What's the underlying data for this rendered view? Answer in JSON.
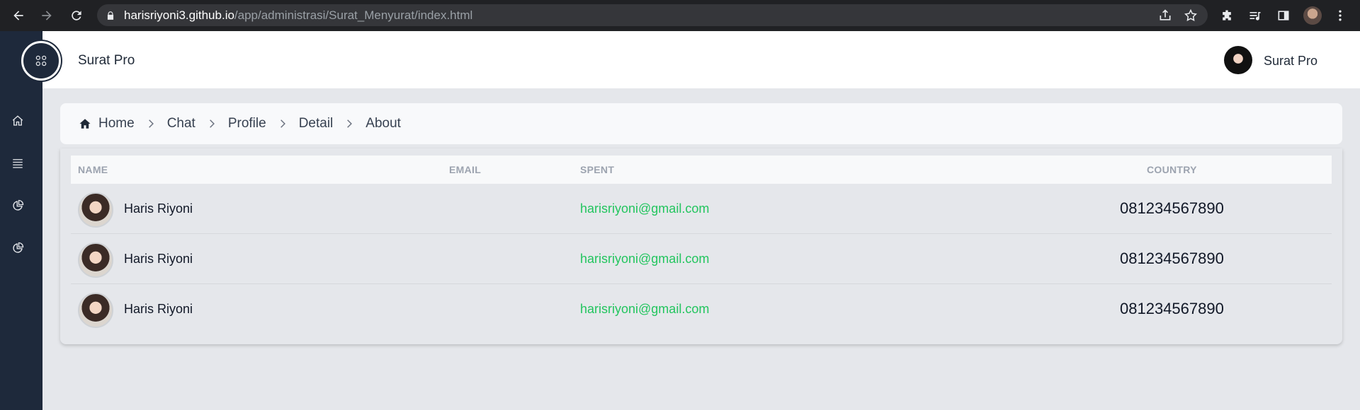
{
  "browser": {
    "url_host": "harisriyoni3.github.io",
    "url_path": "/app/administrasi/Surat_Menyurat/index.html"
  },
  "header": {
    "app_title": "Surat Pro",
    "user_name": "Surat Pro"
  },
  "sidebar": {
    "items": [
      {
        "icon": "home-icon"
      },
      {
        "icon": "menu-icon"
      },
      {
        "icon": "pie-chart-icon"
      },
      {
        "icon": "pie-chart-icon"
      }
    ]
  },
  "breadcrumb": {
    "items": [
      "Home",
      "Chat",
      "Profile",
      "Detail",
      "About"
    ]
  },
  "table": {
    "columns": [
      "NAME",
      "EMAIL",
      "SPENT",
      "COUNTRY"
    ],
    "rows": [
      {
        "name": "Haris Riyoni",
        "email": "harisriyoni@gmail.com",
        "phone": "081234567890"
      },
      {
        "name": "Haris Riyoni",
        "email": "harisriyoni@gmail.com",
        "phone": "081234567890"
      },
      {
        "name": "Haris Riyoni",
        "email": "harisriyoni@gmail.com",
        "phone": "081234567890"
      }
    ]
  },
  "colors": {
    "sidebar": "#1e293b",
    "email_text": "#22c55e",
    "browser_chrome": "#202124"
  }
}
